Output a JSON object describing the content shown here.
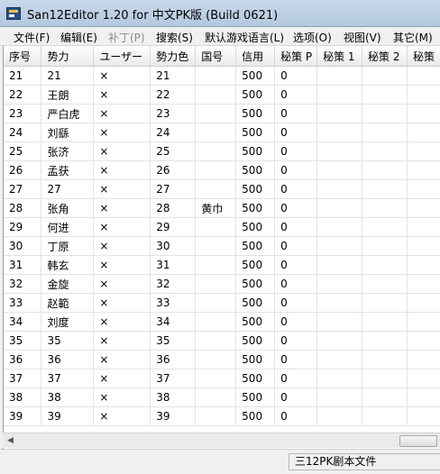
{
  "window": {
    "title": "San12Editor 1.20 for 中文PK版 (Build 0621)"
  },
  "menu": [
    {
      "label": "文件(F)",
      "enabled": true
    },
    {
      "label": "编辑(E)",
      "enabled": true
    },
    {
      "label": "补丁(P)",
      "enabled": false
    },
    {
      "label": "搜索(S)",
      "enabled": true
    },
    {
      "label": "默认游戏语言(L)",
      "enabled": true
    },
    {
      "label": "选项(O)",
      "enabled": true
    },
    {
      "label": "视图(V)",
      "enabled": true
    },
    {
      "label": "其它(M)",
      "enabled": true
    }
  ],
  "table": {
    "columns": [
      "序号",
      "势力",
      "ユーザー",
      "勢力色",
      "国号",
      "信用",
      "秘策 P",
      "秘策 1",
      "秘策 2",
      "秘策"
    ],
    "rows": [
      [
        "21",
        "21",
        "×",
        "21",
        "",
        "500",
        "0",
        "",
        "",
        ""
      ],
      [
        "22",
        "王朗",
        "×",
        "22",
        "",
        "500",
        "0",
        "",
        "",
        ""
      ],
      [
        "23",
        "严白虎",
        "×",
        "23",
        "",
        "500",
        "0",
        "",
        "",
        ""
      ],
      [
        "24",
        "刘繇",
        "×",
        "24",
        "",
        "500",
        "0",
        "",
        "",
        ""
      ],
      [
        "25",
        "张济",
        "×",
        "25",
        "",
        "500",
        "0",
        "",
        "",
        ""
      ],
      [
        "26",
        "孟获",
        "×",
        "26",
        "",
        "500",
        "0",
        "",
        "",
        ""
      ],
      [
        "27",
        "27",
        "×",
        "27",
        "",
        "500",
        "0",
        "",
        "",
        ""
      ],
      [
        "28",
        "张角",
        "×",
        "28",
        "黄巾",
        "500",
        "0",
        "",
        "",
        ""
      ],
      [
        "29",
        "何进",
        "×",
        "29",
        "",
        "500",
        "0",
        "",
        "",
        ""
      ],
      [
        "30",
        "丁原",
        "×",
        "30",
        "",
        "500",
        "0",
        "",
        "",
        ""
      ],
      [
        "31",
        "韩玄",
        "×",
        "31",
        "",
        "500",
        "0",
        "",
        "",
        ""
      ],
      [
        "32",
        "金旋",
        "×",
        "32",
        "",
        "500",
        "0",
        "",
        "",
        ""
      ],
      [
        "33",
        "赵範",
        "×",
        "33",
        "",
        "500",
        "0",
        "",
        "",
        ""
      ],
      [
        "34",
        "刘度",
        "×",
        "34",
        "",
        "500",
        "0",
        "",
        "",
        ""
      ],
      [
        "35",
        "35",
        "×",
        "35",
        "",
        "500",
        "0",
        "",
        "",
        ""
      ],
      [
        "36",
        "36",
        "×",
        "36",
        "",
        "500",
        "0",
        "",
        "",
        ""
      ],
      [
        "37",
        "37",
        "×",
        "37",
        "",
        "500",
        "0",
        "",
        "",
        ""
      ],
      [
        "38",
        "38",
        "×",
        "38",
        "",
        "500",
        "0",
        "",
        "",
        ""
      ],
      [
        "39",
        "39",
        "×",
        "39",
        "",
        "500",
        "0",
        "",
        "",
        ""
      ]
    ]
  },
  "status": {
    "file_type": "三12PK剧本文件"
  },
  "icons": {
    "app": "app-icon",
    "scroll_left": "scroll-left-arrow-icon"
  }
}
